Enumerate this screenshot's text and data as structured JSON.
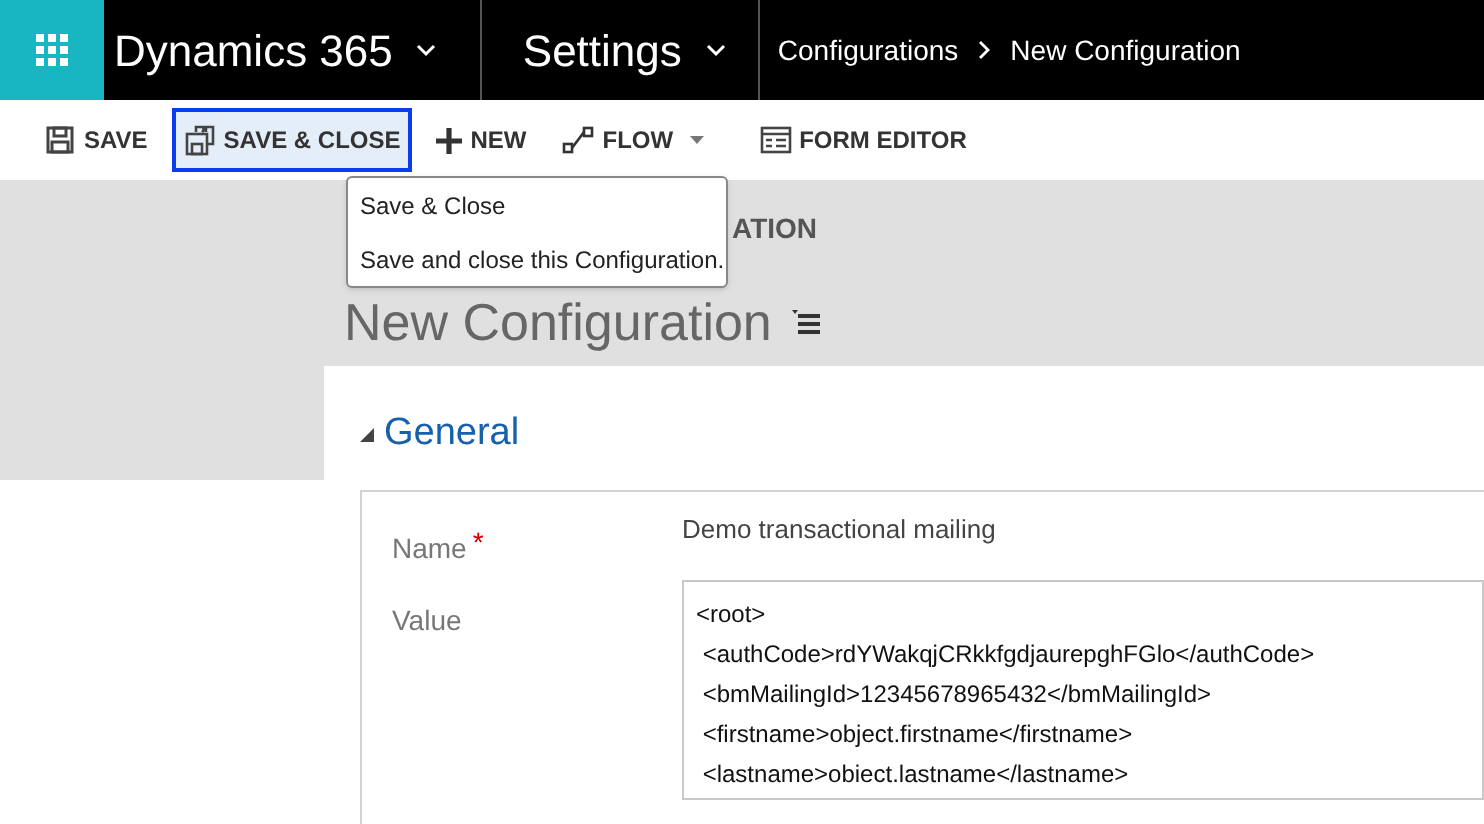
{
  "nav": {
    "app": "Dynamics 365",
    "area": "Settings",
    "breadcrumbs": [
      "Configurations",
      "New Configuration"
    ]
  },
  "toolbar": [
    {
      "label": "SAVE",
      "kind": "save",
      "selected": false
    },
    {
      "label": "SAVE & CLOSE",
      "kind": "save-close",
      "selected": true
    },
    {
      "label": "NEW",
      "kind": "new",
      "selected": false
    },
    {
      "label": "FLOW",
      "kind": "flow",
      "selected": false
    },
    {
      "label": "FORM EDITOR",
      "kind": "form-editor",
      "selected": false
    }
  ],
  "tooltip": {
    "title": "Save & Close",
    "description": "Save and close this Configuration."
  },
  "header": {
    "entity": "ATION",
    "title": "New Configuration"
  },
  "section": {
    "title": "General",
    "expanded": true
  },
  "fields": [
    {
      "label": "Name",
      "required_mark": "*",
      "kind": "text",
      "value": "Demo transactional mailing"
    },
    {
      "label": "Value",
      "kind": "multiline",
      "lines": [
        "<root>",
        " <authCode>rdYWakqjCRkkfgdjaurepghFGlo</authCode>",
        " <bmMailingId>12345678965432</bmMailingId>",
        " <firstname>object.firstname</firstname>",
        " <lastname>obiect.lastname</lastname>"
      ]
    }
  ]
}
